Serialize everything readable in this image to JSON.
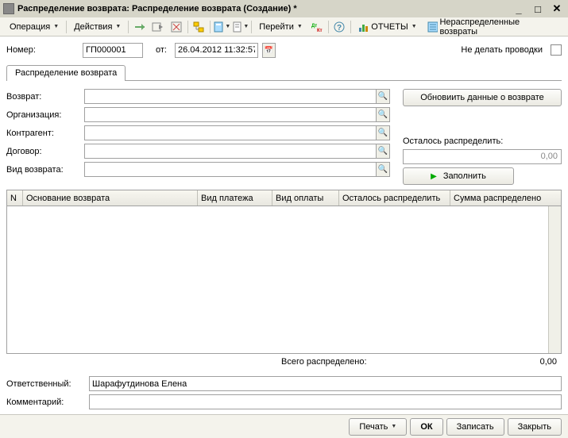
{
  "title": "Распределение возврата: Распределение возврата (Создание) *",
  "toolbar": {
    "operation": "Операция",
    "actions": "Действия",
    "goto": "Перейти",
    "reports": "ОТЧЕТЫ",
    "undistributed": "Нераспределенные возвраты"
  },
  "header": {
    "number_label": "Номер:",
    "number_value": "ГП000001",
    "from_label": "от:",
    "date_value": "26.04.2012 11:32:57",
    "no_posting_label": "Не делать проводки"
  },
  "tab_label": "Распределение возврата",
  "form": {
    "return_label": "Возврат:",
    "org_label": "Организация:",
    "contragent_label": "Контрагент:",
    "contract_label": "Договор:",
    "type_label": "Вид возврата:",
    "refresh_btn": "Обновиить данные о возврате",
    "remain_label": "Осталось распределить:",
    "remain_value": "0,00",
    "fill_btn": "Заполнить"
  },
  "grid": {
    "col_n": "N",
    "col_base": "Основание возврата",
    "col_paytype": "Вид платежа",
    "col_paymethod": "Вид оплаты",
    "col_remain": "Осталось распределить",
    "col_sum": "Сумма распределено"
  },
  "totals": {
    "label": "Всего распределено:",
    "value": "0,00"
  },
  "bottom": {
    "responsible_label": "Ответственный:",
    "responsible_value": "Шарафутдинова Елена",
    "comment_label": "Комментарий:",
    "comment_value": ""
  },
  "footer": {
    "print": "Печать",
    "ok": "ОК",
    "save": "Записать",
    "close": "Закрыть"
  }
}
